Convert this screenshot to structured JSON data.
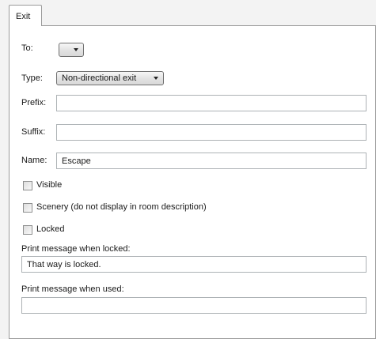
{
  "tab": {
    "label": "Exit"
  },
  "to": {
    "label": "To:",
    "value": ""
  },
  "type": {
    "label": "Type:",
    "selected": "Non-directional exit"
  },
  "prefix": {
    "label": "Prefix:",
    "value": ""
  },
  "suffix": {
    "label": "Suffix:",
    "value": ""
  },
  "name": {
    "label": "Name:",
    "value": "Escape"
  },
  "checkboxes": {
    "visible": "Visible",
    "scenery": "Scenery (do not display in room description)",
    "locked": "Locked"
  },
  "locked_message": {
    "label": "Print message when locked:",
    "value": "That way is locked."
  },
  "used_message": {
    "label": "Print message when used:",
    "value": ""
  }
}
